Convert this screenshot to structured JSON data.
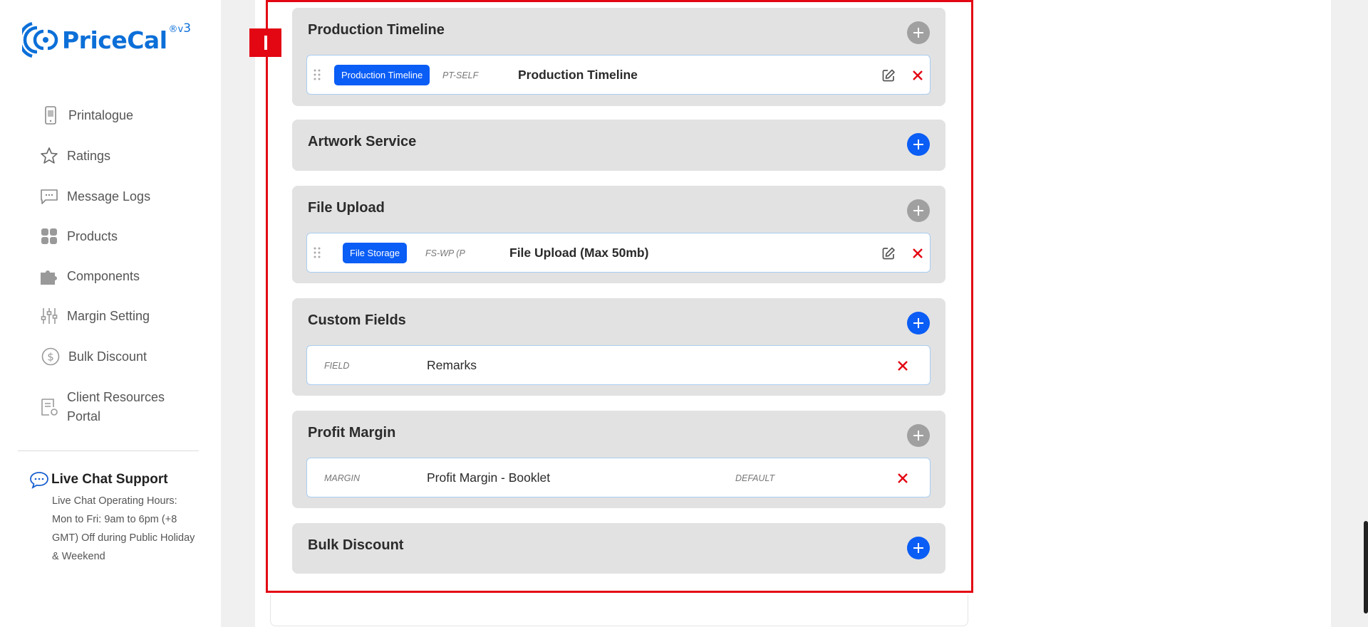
{
  "brand": {
    "name": "PriceCal",
    "version_prefix": "®v",
    "version_number": "3"
  },
  "sidebar": {
    "items": [
      {
        "label": "Printalogue",
        "icon": "phone-catalog-icon"
      },
      {
        "label": "Ratings",
        "icon": "star-icon"
      },
      {
        "label": "Message Logs",
        "icon": "chat-dots-icon"
      },
      {
        "label": "Products",
        "icon": "grid-icon"
      },
      {
        "label": "Components",
        "icon": "puzzle-icon"
      },
      {
        "label": "Margin Setting",
        "icon": "sliders-icon"
      },
      {
        "label": "Bulk Discount",
        "icon": "dollar-circle-icon"
      },
      {
        "label": "Client Resources Portal",
        "icon": "document-user-icon"
      }
    ]
  },
  "support": {
    "title": "Live Chat Support",
    "text": "Live Chat Operating Hours: Mon to Fri: 9am to 6pm (+8 GMT) Off during Public Holiday & Weekend"
  },
  "sections": [
    {
      "title": "Production Timeline",
      "add_state": "disabled",
      "items": [
        {
          "tag": "Production Timeline",
          "code": "PT-SELF",
          "name": "Production Timeline"
        }
      ]
    },
    {
      "title": "Artwork Service",
      "add_state": "enabled",
      "items": []
    },
    {
      "title": "File Upload",
      "add_state": "disabled",
      "items": [
        {
          "tag": "File Storage",
          "code": "FS-WP (P",
          "name": "File Upload (Max 50mb)"
        }
      ]
    },
    {
      "title": "Custom Fields",
      "add_state": "enabled",
      "items": [
        {
          "code": "FIELD",
          "name": "Remarks"
        }
      ]
    },
    {
      "title": "Profit Margin",
      "add_state": "disabled",
      "items": [
        {
          "code": "MARGIN",
          "name": "Profit Margin - Booklet",
          "extra": "DEFAULT"
        }
      ]
    },
    {
      "title": "Bulk Discount",
      "add_state": "enabled",
      "items": []
    }
  ],
  "colors": {
    "accent_blue": "#0a5df5",
    "logo_blue": "#0c6fd8",
    "highlight_red": "#e30613",
    "delete_red": "#e30613",
    "disabled_grey": "#a0a0a0"
  }
}
